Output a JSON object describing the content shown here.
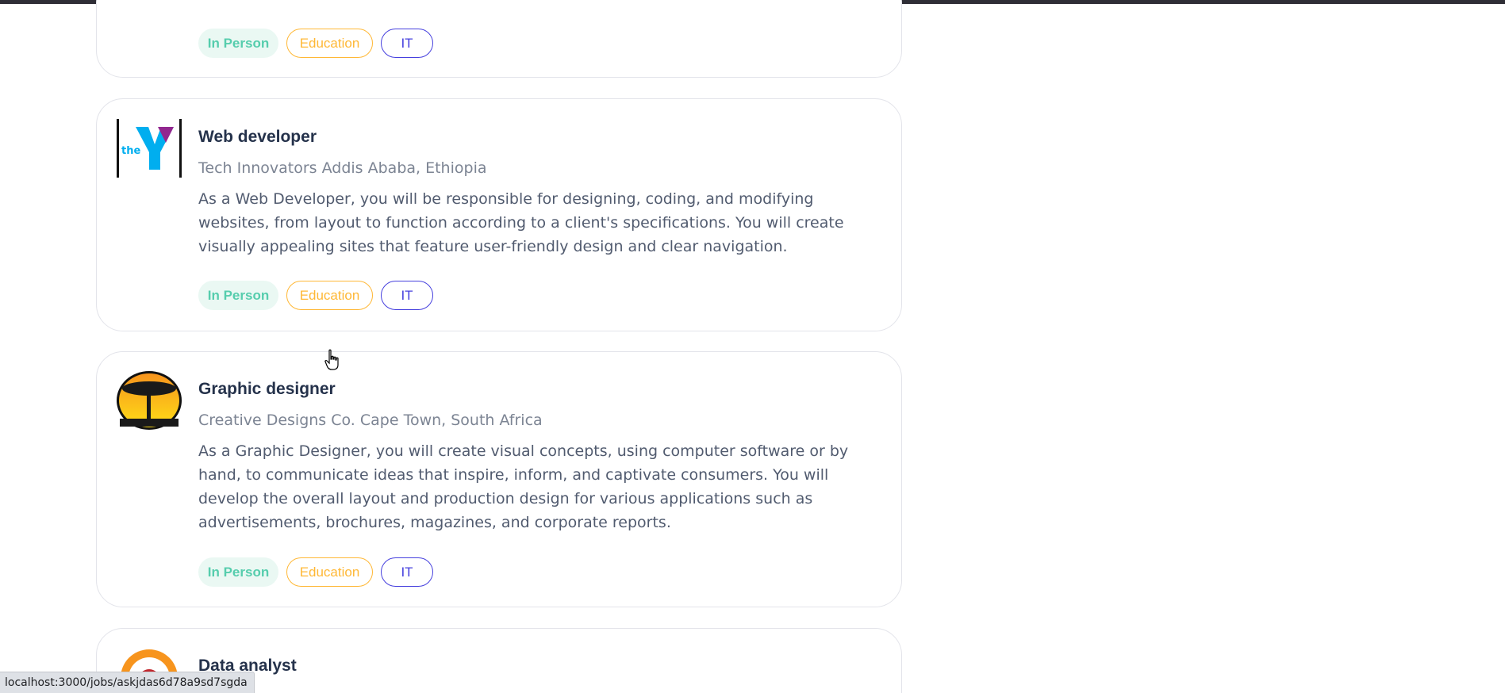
{
  "jobs": [
    {
      "title": "",
      "company": "",
      "description": "",
      "tags": {
        "mode": "In Person",
        "field": "Education",
        "category": "IT"
      }
    },
    {
      "title": "Web developer",
      "company": "Tech Innovators Addis Ababa, Ethiopia",
      "description": "As a Web Developer, you will be responsible for designing, coding, and modifying websites, from layout to function according to a client's specifications. You will create visually appealing sites that feature user-friendly design and clear navigation.",
      "tags": {
        "mode": "In Person",
        "field": "Education",
        "category": "IT"
      },
      "logo": {
        "text": "the",
        "name": "ymca-logo-icon"
      }
    },
    {
      "title": "Graphic designer",
      "company": "Creative Designs Co. Cape Town, South Africa",
      "description": "As a Graphic Designer, you will create visual concepts, using computer software or by hand, to communicate ideas that inspire, inform, and captivate consumers. You will develop the overall layout and production design for various applications such as advertisements, brochures, magazines, and corporate reports.",
      "tags": {
        "mode": "In Person",
        "field": "Education",
        "category": "IT"
      },
      "logo": {
        "name": "acacia-tree-logo-icon"
      }
    },
    {
      "title": "Data analyst",
      "company": "",
      "logo": {
        "name": "africa-badge-logo-icon"
      }
    }
  ],
  "status_bar": {
    "url": "localhost:3000/jobs/askjdas6d78a9sd7sgda"
  },
  "colors": {
    "mode_tag": "#56cdad",
    "field_tag": "#ffb836",
    "category_tag": "#4640de",
    "title": "#25324b",
    "muted": "#7c8493"
  }
}
